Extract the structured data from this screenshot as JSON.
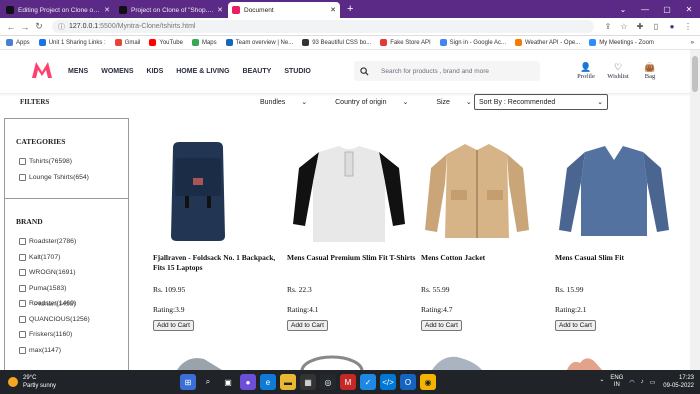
{
  "browser": {
    "tabs": [
      {
        "title": "Editing Project on Clone of \"Myn",
        "color": "#222",
        "active": false
      },
      {
        "title": "Project on Clone of \"Shop.com\"...",
        "color": "#222",
        "active": false
      },
      {
        "title": "Document",
        "color": "#e91e63",
        "active": true
      }
    ],
    "new_tab": "+",
    "url_host": "127.0.0.1",
    "url_path": ":5500/Myntra-Clone/tshirts.html",
    "bookmarks": [
      "Apps",
      "Unit 1 Sharing Links :",
      "Gmail",
      "YouTube",
      "Maps",
      "Team overview | Ne...",
      "93 Beautiful CSS bo...",
      "Fake Store API",
      "Sign in - Google Ac...",
      "Weather API - Ope...",
      "My Meetings - Zoom"
    ],
    "other_bookmarks": "»"
  },
  "site": {
    "nav": [
      "MENS",
      "WOMENS",
      "KIDS",
      "HOME & LIVING",
      "BEAUTY",
      "STUDIO"
    ],
    "search_placeholder": "Search for products , brand and more",
    "actions": [
      {
        "label": "Profile",
        "icon": "person-icon"
      },
      {
        "label": "Wishlist",
        "icon": "heart-icon"
      },
      {
        "label": "Bag",
        "icon": "bag-icon"
      }
    ],
    "filters_title": "FILTERS",
    "dropdowns": [
      "Bundles",
      "Country of origin",
      "Size"
    ],
    "sort": "Sort By : Recommended",
    "categories_title": "CATEGORIES",
    "categories": [
      "Tshirts(76598)",
      "Lounge Tshirts(654)"
    ],
    "brand_title": "BRAND",
    "brands": [
      "Roadster(2786)",
      "Kalt(1707)",
      "WROGN(1691)",
      "Puma(1583)",
      "Roadster(1469)",
      "QUANCIOUS(1256)",
      "Friskers(1160)",
      "max(1147)"
    ],
    "brand_overlap_text": "Pfdrlarf(1456)",
    "products": [
      {
        "name": "Fjallraven - Foldsack No. 1 Backpack, Fits 15 Laptops",
        "price": "Rs. 109.95",
        "rating": "Rating:3.9",
        "button": "Add to Cart"
      },
      {
        "name": "Mens Casual Premium Slim Fit T-Shirts",
        "price": "Rs. 22.3",
        "rating": "Rating:4.1",
        "button": "Add to Cart"
      },
      {
        "name": "Mens Cotton Jacket",
        "price": "Rs. 55.99",
        "rating": "Rating:4.7",
        "button": "Add to Cart"
      },
      {
        "name": "Mens Casual Slim Fit",
        "price": "Rs. 15.99",
        "rating": "Rating:2.1",
        "button": "Add to Cart"
      }
    ]
  },
  "taskbar": {
    "temp": "29°C",
    "weather": "Partly sunny",
    "lang1": "ENG",
    "lang2": "IN",
    "time": "17:23",
    "date": "09-05-2022"
  }
}
